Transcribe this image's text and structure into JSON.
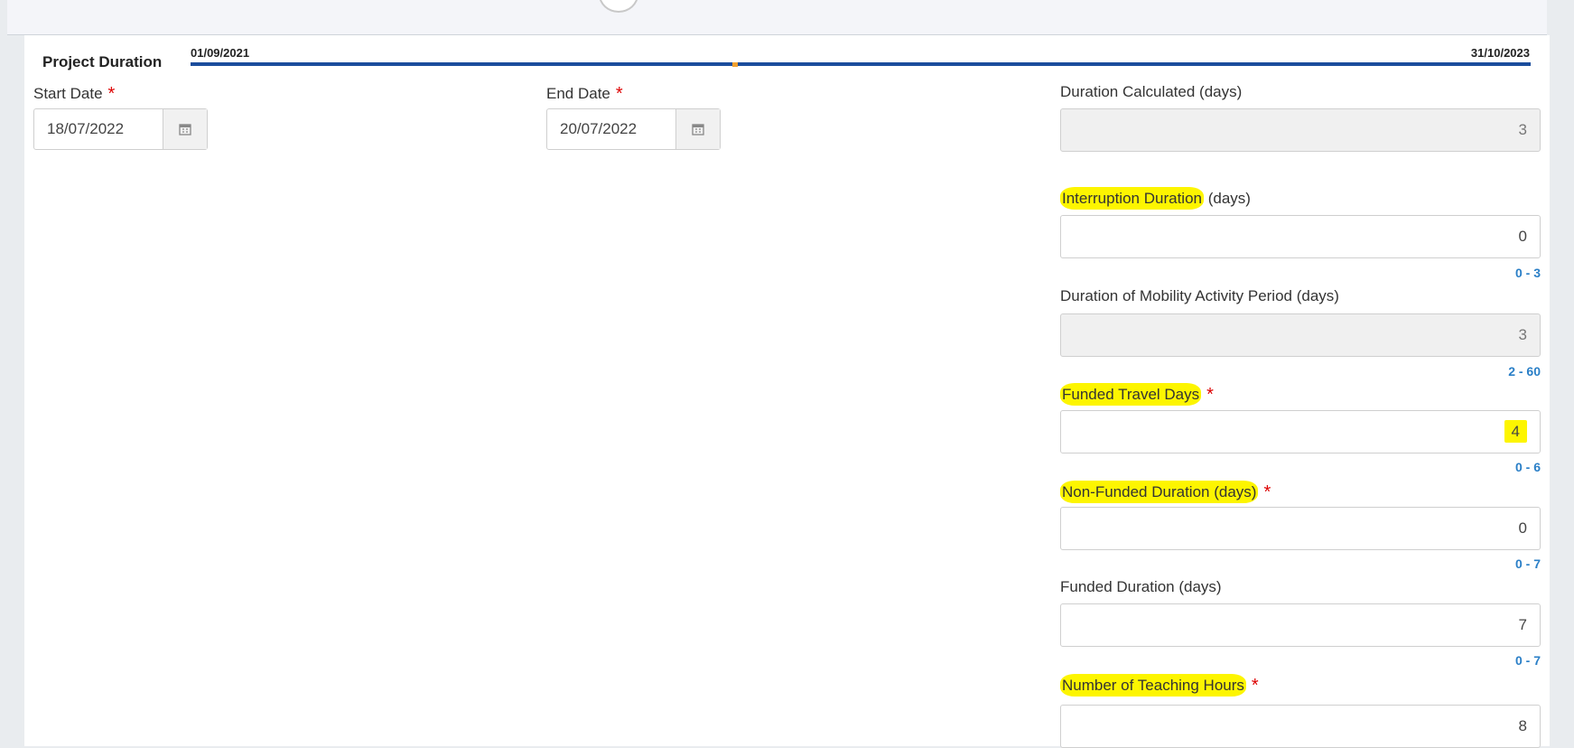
{
  "project_duration": {
    "label": "Project Duration",
    "timeline_start": "01/09/2021",
    "timeline_end": "31/10/2023"
  },
  "start_date": {
    "label": "Start Date",
    "required_mark": "*",
    "value": "18/07/2022"
  },
  "end_date": {
    "label": "End Date",
    "required_mark": "*",
    "value": "20/07/2022"
  },
  "fields": {
    "duration_calculated": {
      "label": "Duration Calculated (days)",
      "value": "3"
    },
    "interruption_duration": {
      "label_highlighted": "Interruption Duration",
      "label_rest": " (days)",
      "value": "0",
      "range": "0 - 3"
    },
    "mobility_period": {
      "label": "Duration of Mobility Activity Period (days)",
      "value": "3",
      "range": "2 - 60"
    },
    "funded_travel_days": {
      "label": "Funded Travel Days",
      "required_mark": "*",
      "value": "4",
      "range": "0 - 6"
    },
    "non_funded_duration": {
      "label": "Non-Funded Duration (days)",
      "required_mark": "*",
      "value": "0",
      "range": "0 - 7"
    },
    "funded_duration": {
      "label": "Funded Duration (days)",
      "value": "7",
      "range": "0 - 7"
    },
    "teaching_hours": {
      "label": "Number of Teaching Hours",
      "required_mark": "*",
      "value": "8"
    }
  },
  "colors": {
    "highlight": "#fdf500",
    "timeline": "#1b4d9c",
    "timeline_marker": "#f0a030",
    "range_text": "#2a7fc7",
    "required": "#dd0000"
  },
  "icons": {
    "calendar": "calendar-icon"
  }
}
